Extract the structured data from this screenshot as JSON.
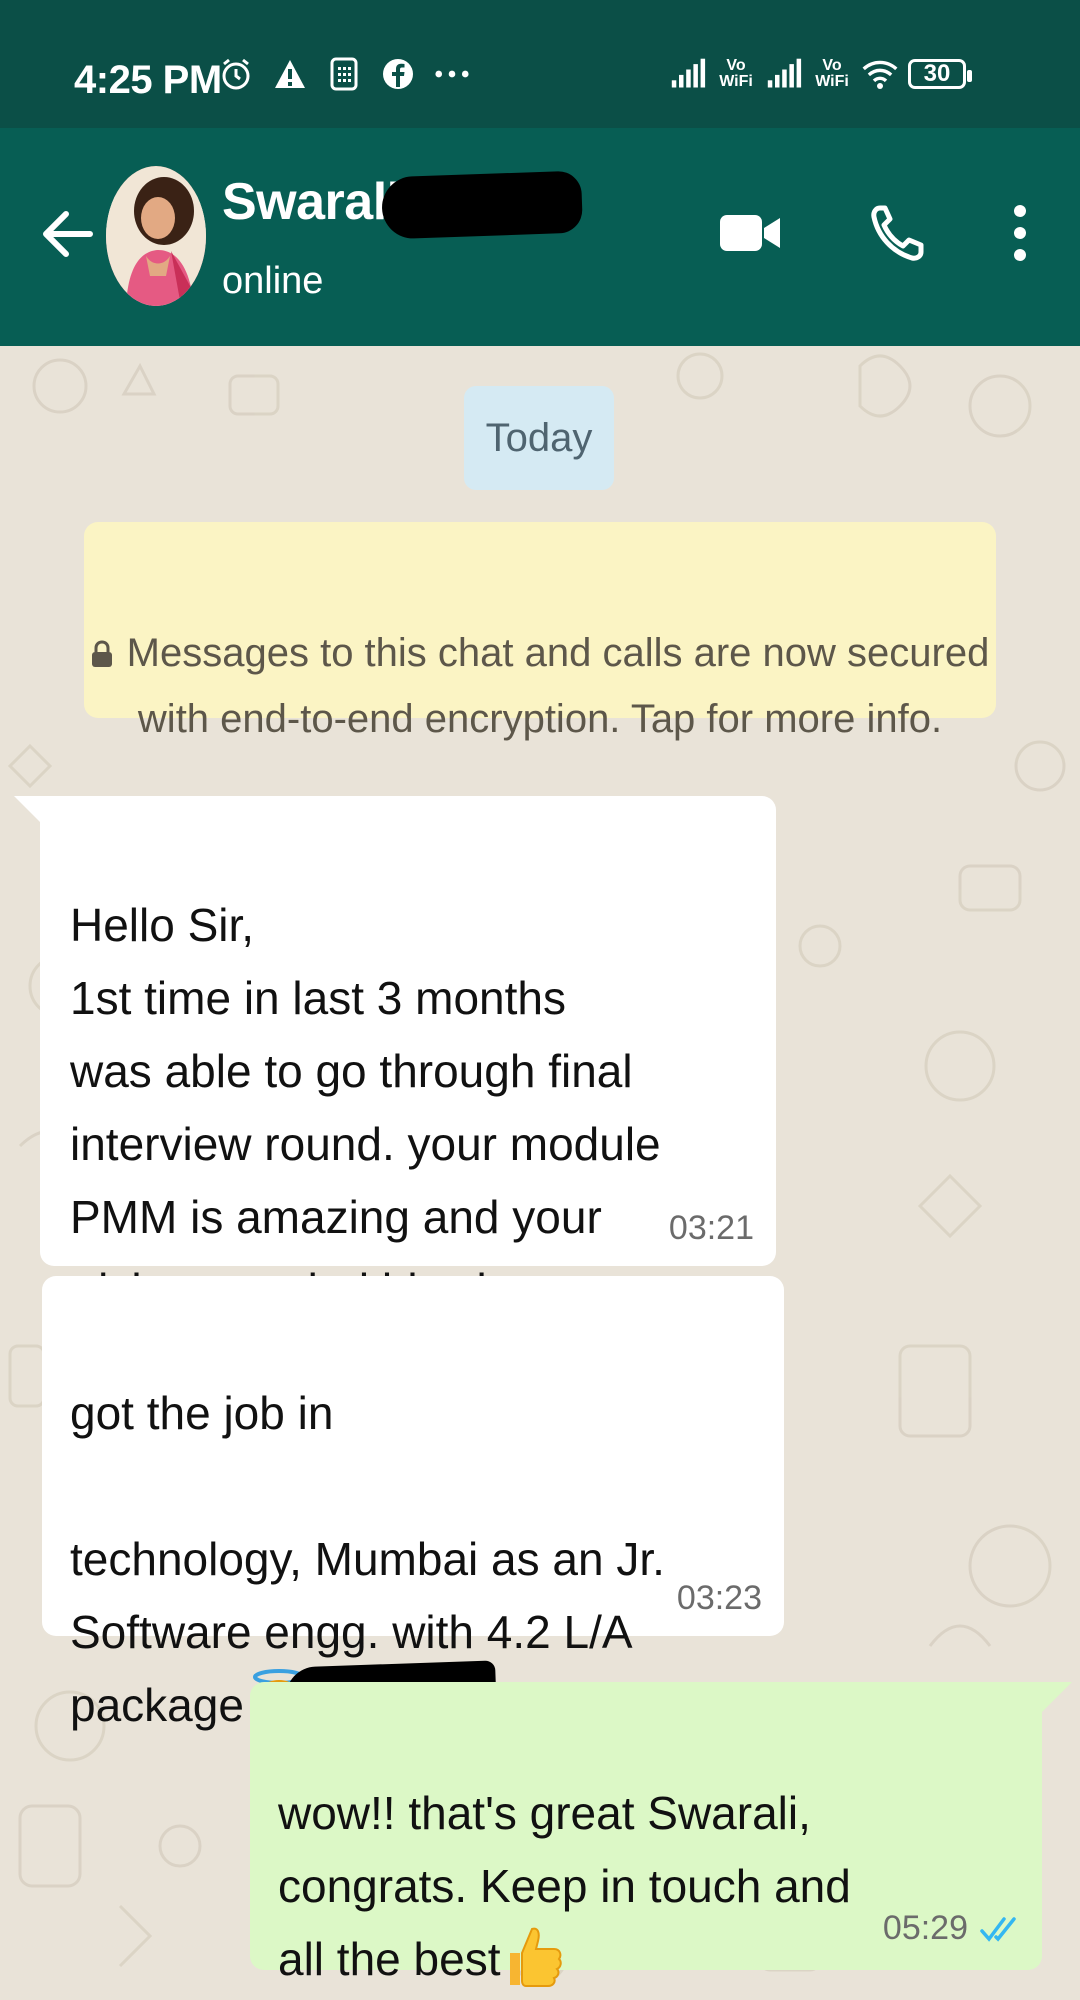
{
  "status_bar": {
    "time": "4:25 PM",
    "left_icons": [
      "alarm-icon",
      "alert-triangle-icon",
      "sim-card-icon",
      "facebook-icon",
      "more-icon"
    ],
    "network_1": "Vo WiFi",
    "network_2": "Vo WiFi",
    "battery": "30"
  },
  "header": {
    "contact_name": "Swarali",
    "contact_status": "online",
    "icons": [
      "back-arrow-icon",
      "video-call-icon",
      "phone-icon",
      "more-vertical-icon"
    ],
    "bar_color": "#075e54",
    "status_bar_color": "#0b4f47"
  },
  "chat": {
    "date_chip": "Today",
    "encryption_notice": "Messages to this chat and calls are now secured\nwith end-to-end encryption. Tap for more info.",
    "messages": [
      {
        "direction": "incoming",
        "text": "Hello Sir,\n1st time in last 3 months\nwas able to go through final\ninterview round. your module\nPMM is amazing and your\ntricks are mind blowing",
        "time": "03:21"
      },
      {
        "direction": "incoming",
        "text_part1": "got the job in",
        "text_part2": "technology, Mumbai as an Jr.\nSoftware engg. with 4.2 L/A\npackage",
        "emoji": "smiling-face-with-halo",
        "time": "03:23"
      },
      {
        "direction": "outgoing",
        "text": "wow!! that's great Swarali,\ncongrats. Keep in touch and\nall the best",
        "emoji": "thumbs-up",
        "time": "05:29",
        "read_status": "read-double-tick"
      }
    ],
    "incoming_bubble_color": "#ffffff",
    "outgoing_bubble_color": "#dcf8c6",
    "read_tick_color": "#34b7f1"
  }
}
